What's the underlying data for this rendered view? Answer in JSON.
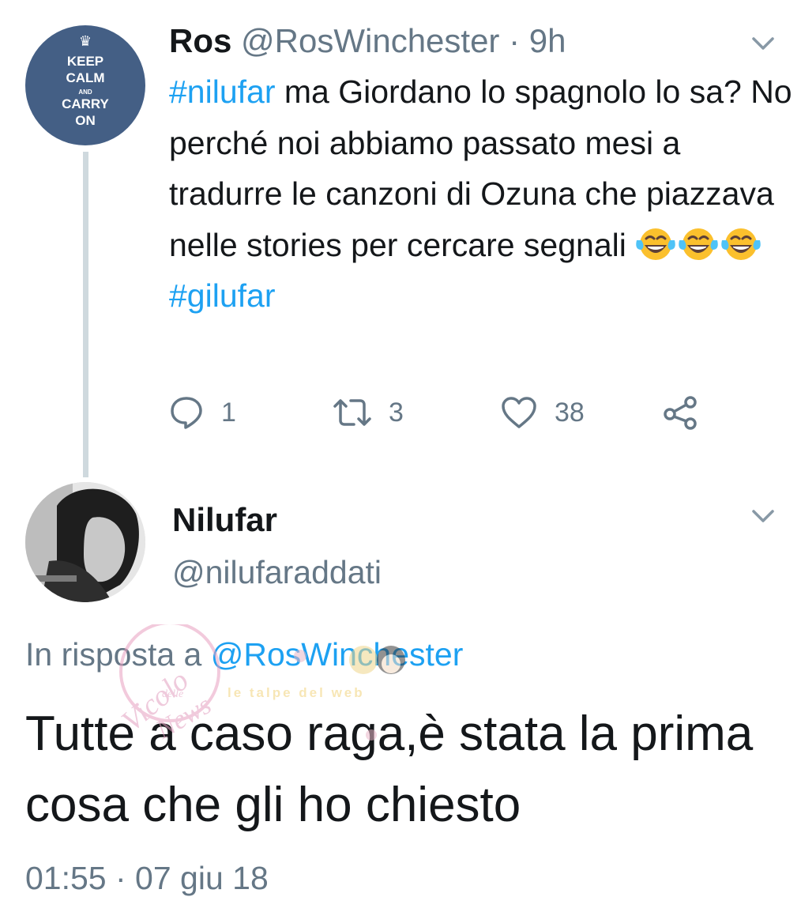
{
  "first_tweet": {
    "author_name": "Ros",
    "author_handle": "@RosWinchester",
    "separator": "·",
    "time": "9h",
    "avatar_text": [
      "KEEP",
      "CALM",
      "AND",
      "CARRY",
      "ON"
    ],
    "text": {
      "hashtag1": "#nilufar",
      "line1_rest": " ma Giordano lo spagnolo lo sa? No perché noi abbiamo passato mesi a tradurre le canzoni di Ozuna che piazzava nelle stories per cercare segnali ",
      "hashtag2": "#gilufar"
    },
    "emoji_count": 3,
    "actions": {
      "replies": "1",
      "retweets": "3",
      "likes": "38"
    }
  },
  "reply_tweet": {
    "author_name": "Nilufar",
    "author_handle": "@nilufaraddati",
    "reply_prefix": "In risposta a",
    "reply_mention": "@RosWinchester",
    "text": "Tutte a caso raga,è stata la prima cosa che gli ho chiesto",
    "timestamp": "01:55 · 07 giu 18"
  },
  "watermark": {
    "text1": "Vicolo delle News",
    "text2": "le talpe del web"
  },
  "colors": {
    "accent": "#1da1f2",
    "secondary_text": "#657786",
    "thread_line": "#cfd9de",
    "avatar_bg": "#445f85"
  }
}
